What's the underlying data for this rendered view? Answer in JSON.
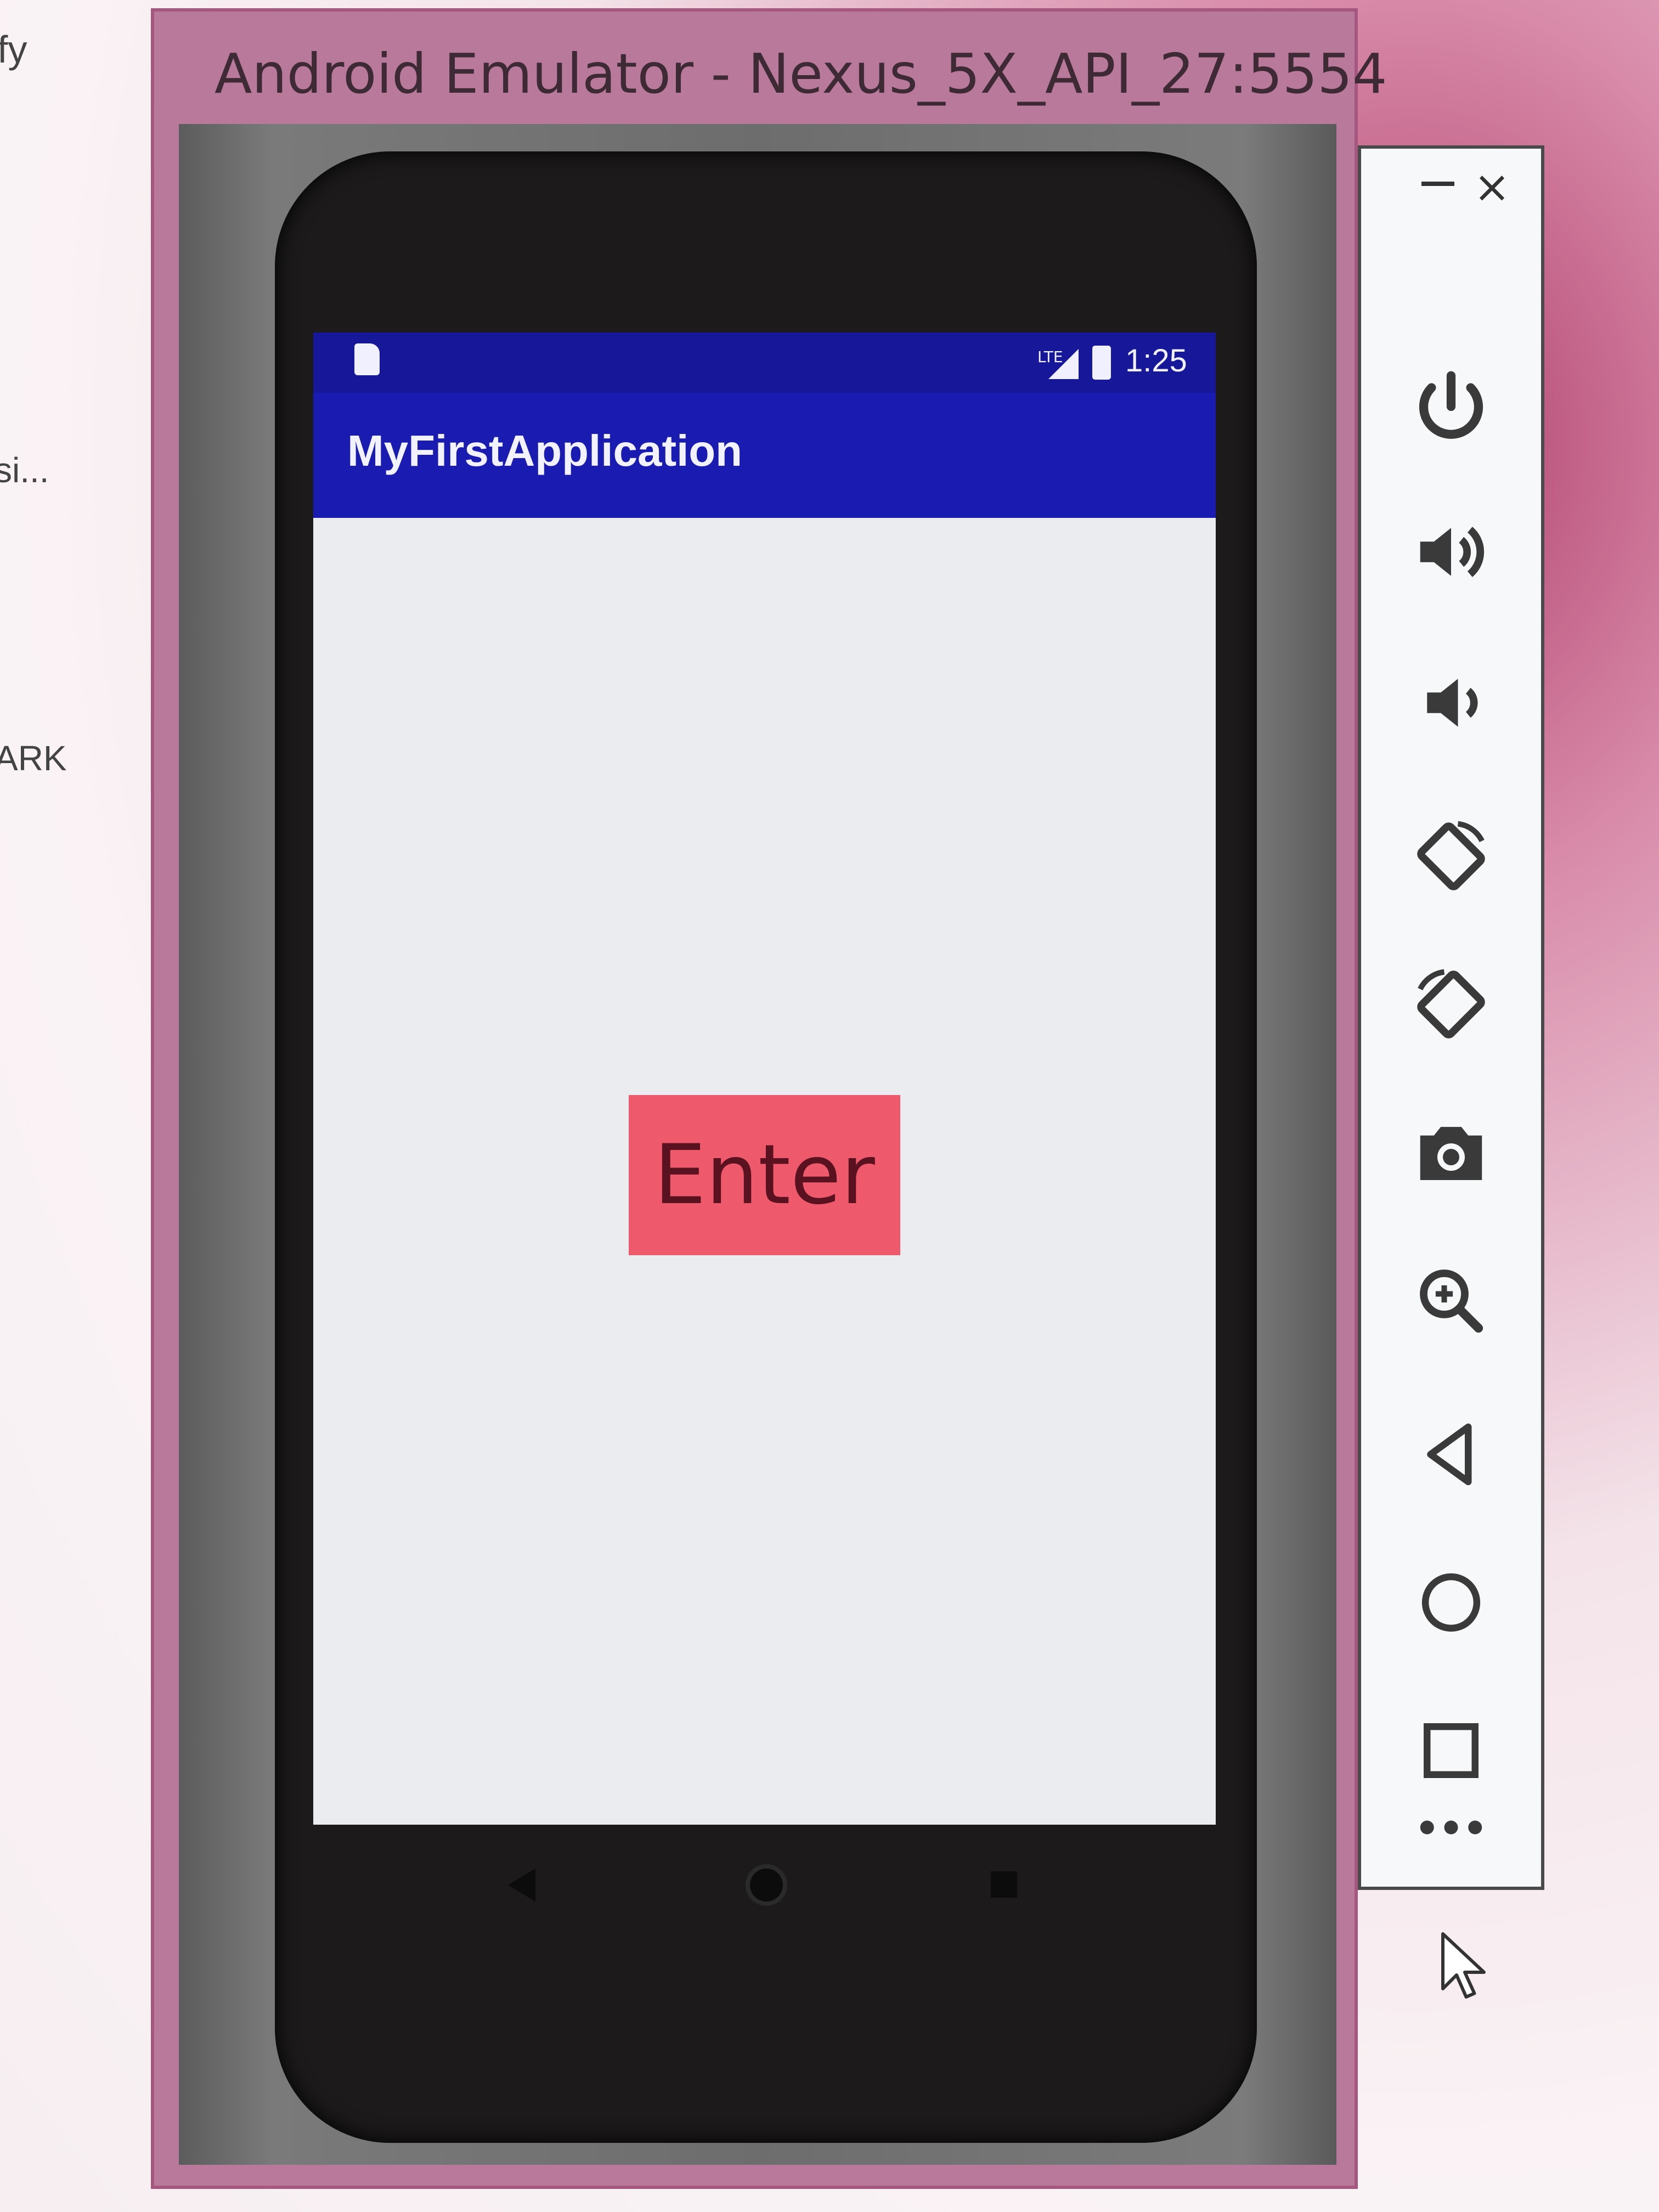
{
  "desktop": {
    "fragments": [
      "fy",
      "si...",
      "ARK"
    ]
  },
  "window": {
    "title": "Android Emulator - Nexus_5X_API_27:5554"
  },
  "status_bar": {
    "time": "1:25",
    "network_label": "LTE"
  },
  "app": {
    "title": "MyFirstApplication",
    "button_label": "Enter"
  },
  "colors": {
    "status_bar": "#17179a",
    "app_bar": "#1a1bb0",
    "button": "#ee5a6b"
  },
  "toolbar": {
    "items": [
      "minimize-icon",
      "close-icon",
      "power-icon",
      "volume-up-icon",
      "volume-down-icon",
      "rotate-left-icon",
      "rotate-right-icon",
      "camera-icon",
      "zoom-icon",
      "back-icon",
      "home-icon",
      "overview-icon",
      "more-icon"
    ]
  }
}
